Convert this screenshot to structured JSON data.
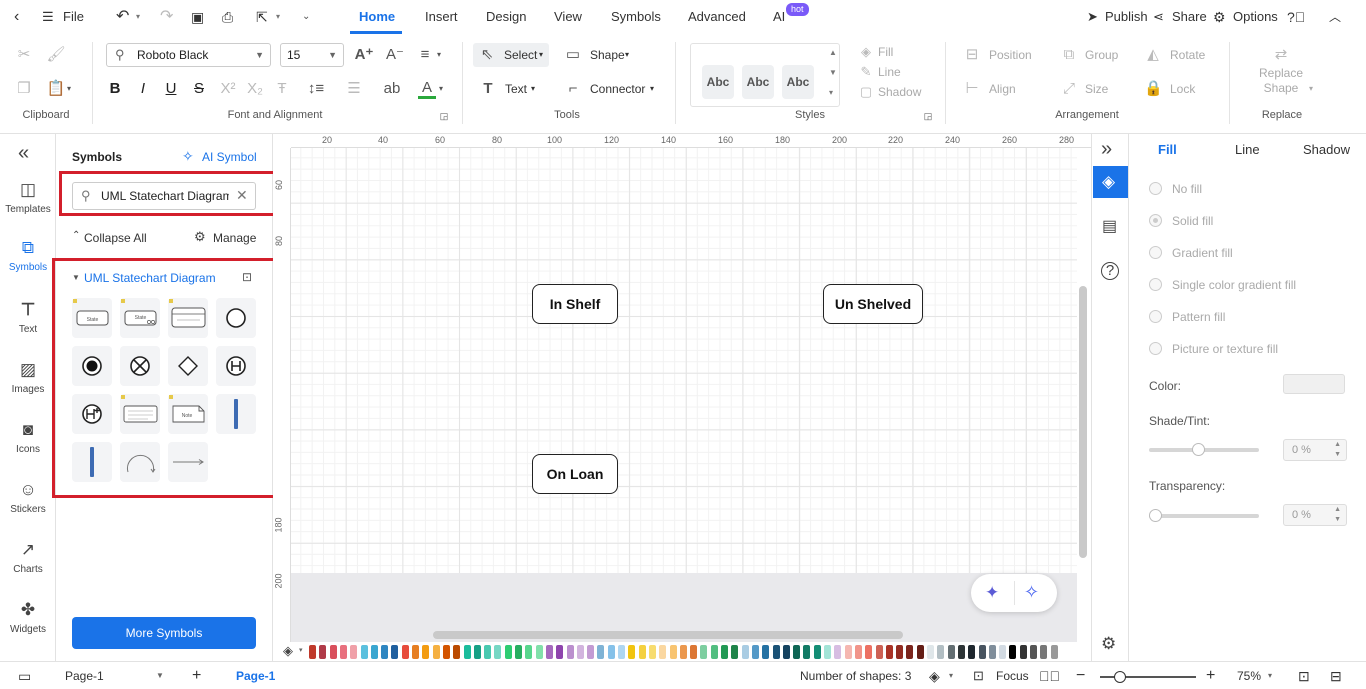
{
  "topbar": {
    "file_label": "File",
    "tabs": [
      {
        "label": "Home",
        "active": true
      },
      {
        "label": "Insert"
      },
      {
        "label": "Design"
      },
      {
        "label": "View"
      },
      {
        "label": "Symbols"
      },
      {
        "label": "Advanced"
      },
      {
        "label": "AI"
      }
    ],
    "hot_badge": "hot",
    "publish_label": "Publish",
    "share_label": "Share",
    "options_label": "Options"
  },
  "ribbon": {
    "groups": {
      "clipboard": "Clipboard",
      "font": "Font and Alignment",
      "tools": "Tools",
      "styles": "Styles",
      "arrangement": "Arrangement",
      "replace": "Replace"
    },
    "font_name": "Roboto Black",
    "font_size": "15",
    "select_label": "Select",
    "shape_label": "Shape",
    "text_label": "Text",
    "connector_label": "Connector",
    "style_samples": [
      "Abc",
      "Abc",
      "Abc"
    ],
    "fill_label": "Fill",
    "line_label": "Line",
    "shadow_label": "Shadow",
    "position_label": "Position",
    "group_label": "Group",
    "rotate_label": "Rotate",
    "align_label": "Align",
    "size_label": "Size",
    "lock_label": "Lock",
    "replace_shape_line1": "Replace",
    "replace_shape_line2": "Shape"
  },
  "rail": {
    "items": [
      {
        "label": "Templates"
      },
      {
        "label": "Symbols"
      },
      {
        "label": "Text"
      },
      {
        "label": "Images"
      },
      {
        "label": "Icons"
      },
      {
        "label": "Stickers"
      },
      {
        "label": "Charts"
      },
      {
        "label": "Widgets"
      }
    ]
  },
  "symbols": {
    "title": "Symbols",
    "ai_symbol": "AI Symbol",
    "search_value": "UML Statechart Diagram",
    "collapse_all": "Collapse All",
    "manage": "Manage",
    "category": "UML Statechart Diagram",
    "more_symbols": "More Symbols",
    "thumb_text": {
      "state": "State",
      "note": "Note"
    }
  },
  "canvas": {
    "ruler_h": [
      "20",
      "40",
      "60",
      "80",
      "100",
      "120",
      "140",
      "160",
      "180",
      "200",
      "220",
      "240",
      "260",
      "280"
    ],
    "ruler_v": [
      "60",
      "80",
      "180",
      "200"
    ],
    "states": [
      {
        "label": "In Shelf"
      },
      {
        "label": "Un Shelved"
      },
      {
        "label": "On Loan"
      }
    ]
  },
  "palette": {
    "colors": [
      "#c0392b",
      "#b03a48",
      "#d94f5c",
      "#e8707e",
      "#f0a0a8",
      "#5bc0de",
      "#3aa6d0",
      "#2e86c1",
      "#1f5f9e",
      "#e74c3c",
      "#e67e22",
      "#f39c12",
      "#f5b041",
      "#d35400",
      "#ba4a00",
      "#1abc9c",
      "#16a085",
      "#48c9b0",
      "#76d7c4",
      "#2ecc71",
      "#27ae60",
      "#58d68d",
      "#82e0aa",
      "#a569bd",
      "#8e44ad",
      "#bb8fce",
      "#d2b4de",
      "#c39bd3",
      "#7fb3d5",
      "#85c1e9",
      "#aed6f1",
      "#f1c40f",
      "#f4d03f",
      "#f7dc6f",
      "#fad7a0",
      "#f8c471",
      "#eb984e",
      "#dc7633",
      "#7dcea0",
      "#52be80",
      "#229954",
      "#1e8449",
      "#a9cce3",
      "#5499c7",
      "#2471a3",
      "#1a5276",
      "#154360",
      "#0e6655",
      "#117a65",
      "#138d75",
      "#a3e4d7",
      "#d7bde2",
      "#f5b7b1",
      "#f1948a",
      "#ec7063",
      "#cd6155",
      "#a93226",
      "#922b21",
      "#7b241c",
      "#641e16",
      "#dfe6e9",
      "#b2bec3",
      "#636e72",
      "#2d3436",
      "#1e272e",
      "#485460",
      "#808e9b",
      "#d2dae2",
      "#000000",
      "#333333",
      "#555555",
      "#777777",
      "#999999"
    ]
  },
  "properties": {
    "tabs": [
      {
        "label": "Fill",
        "active": true
      },
      {
        "label": "Line"
      },
      {
        "label": "Shadow"
      }
    ],
    "fill_options": [
      {
        "label": "No fill"
      },
      {
        "label": "Solid fill"
      },
      {
        "label": "Gradient fill"
      },
      {
        "label": "Single color gradient fill"
      },
      {
        "label": "Pattern fill"
      },
      {
        "label": "Picture or texture fill"
      }
    ],
    "color_label": "Color:",
    "shade_label": "Shade/Tint:",
    "shade_value": "0 %",
    "shade_level": 0.45,
    "transparency_label": "Transparency:",
    "transparency_value": "0 %",
    "transparency_level": 0
  },
  "status": {
    "page_selector": "Page-1",
    "page_tab": "Page-1",
    "shape_count": "Number of shapes: 3",
    "focus_label": "Focus",
    "zoom": "75%"
  }
}
